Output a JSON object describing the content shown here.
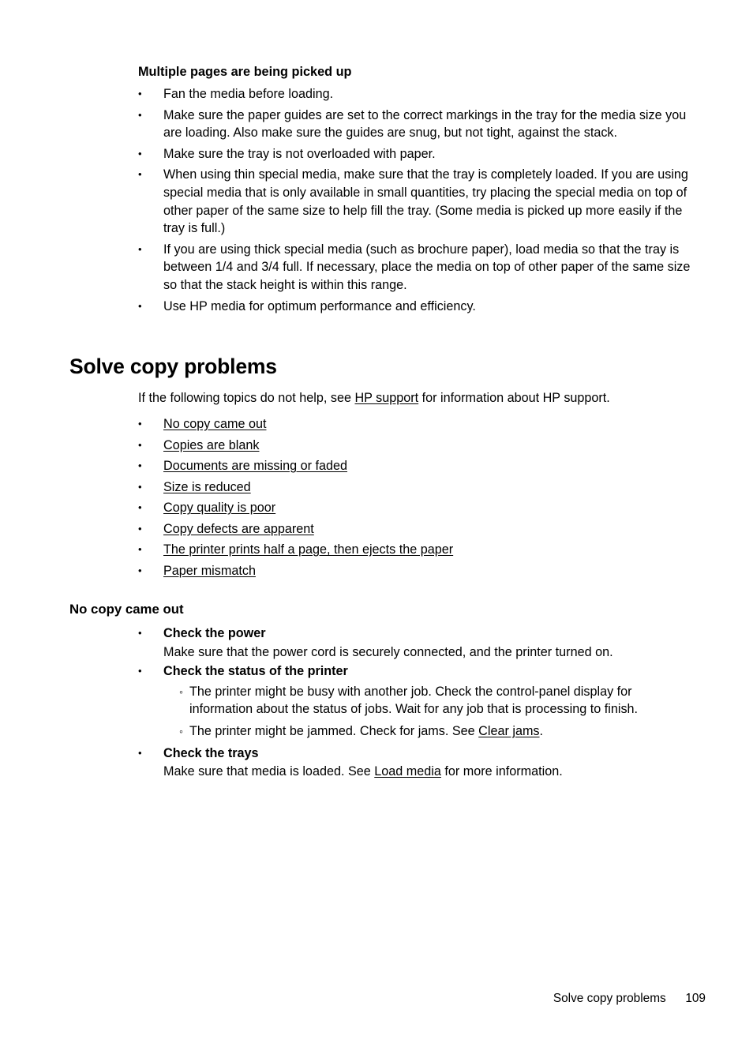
{
  "page": {
    "background_color": "#ffffff",
    "text_color": "#000000"
  },
  "multiple_pages_section": {
    "heading": "Multiple pages are being picked up",
    "bullets": [
      "Fan the media before loading.",
      "Make sure the paper guides are set to the correct markings in the tray for the media size you are loading. Also make sure the guides are snug, but not tight, against the stack.",
      "Make sure the tray is not overloaded with paper.",
      "When using thin special media, make sure that the tray is completely loaded. If you are using special media that is only available in small quantities, try placing the special media on top of other paper of the same size to help fill the tray. (Some media is picked up more easily if the tray is full.)",
      "If you are using thick special media (such as brochure paper), load media so that the tray is between 1/4 and 3/4 full. If necessary, place the media on top of other paper of the same size so that the stack height is within this range.",
      "Use HP media for optimum performance and efficiency."
    ]
  },
  "solve_copy_problems": {
    "title": "Solve copy problems",
    "intro": {
      "before_link": "If the following topics do not help, see ",
      "link": "HP support",
      "after_link": " for information about HP support."
    },
    "topics": [
      "No copy came out",
      "Copies are blank",
      "Documents are missing or faded",
      "Size is reduced",
      "Copy quality is poor",
      "Copy defects are apparent",
      "The printer prints half a page, then ejects the paper",
      "Paper mismatch"
    ]
  },
  "no_copy_came_out": {
    "heading": "No copy came out",
    "items": [
      {
        "title": "Check the power",
        "body": "Make sure that the power cord is securely connected, and the printer turned on."
      },
      {
        "title": "Check the status of the printer",
        "subitems": [
          {
            "text": "The printer might be busy with another job. Check the control-panel display for information about the status of jobs. Wait for any job that is processing to finish."
          },
          {
            "before_link": "The printer might be jammed. Check for jams. See ",
            "link": "Clear jams",
            "after_link": "."
          }
        ]
      },
      {
        "title": "Check the trays",
        "body_before_link": "Make sure that media is loaded. See ",
        "body_link": "Load media",
        "body_after_link": " for more information."
      }
    ]
  },
  "footer": {
    "title": "Solve copy problems",
    "page_number": "109"
  }
}
